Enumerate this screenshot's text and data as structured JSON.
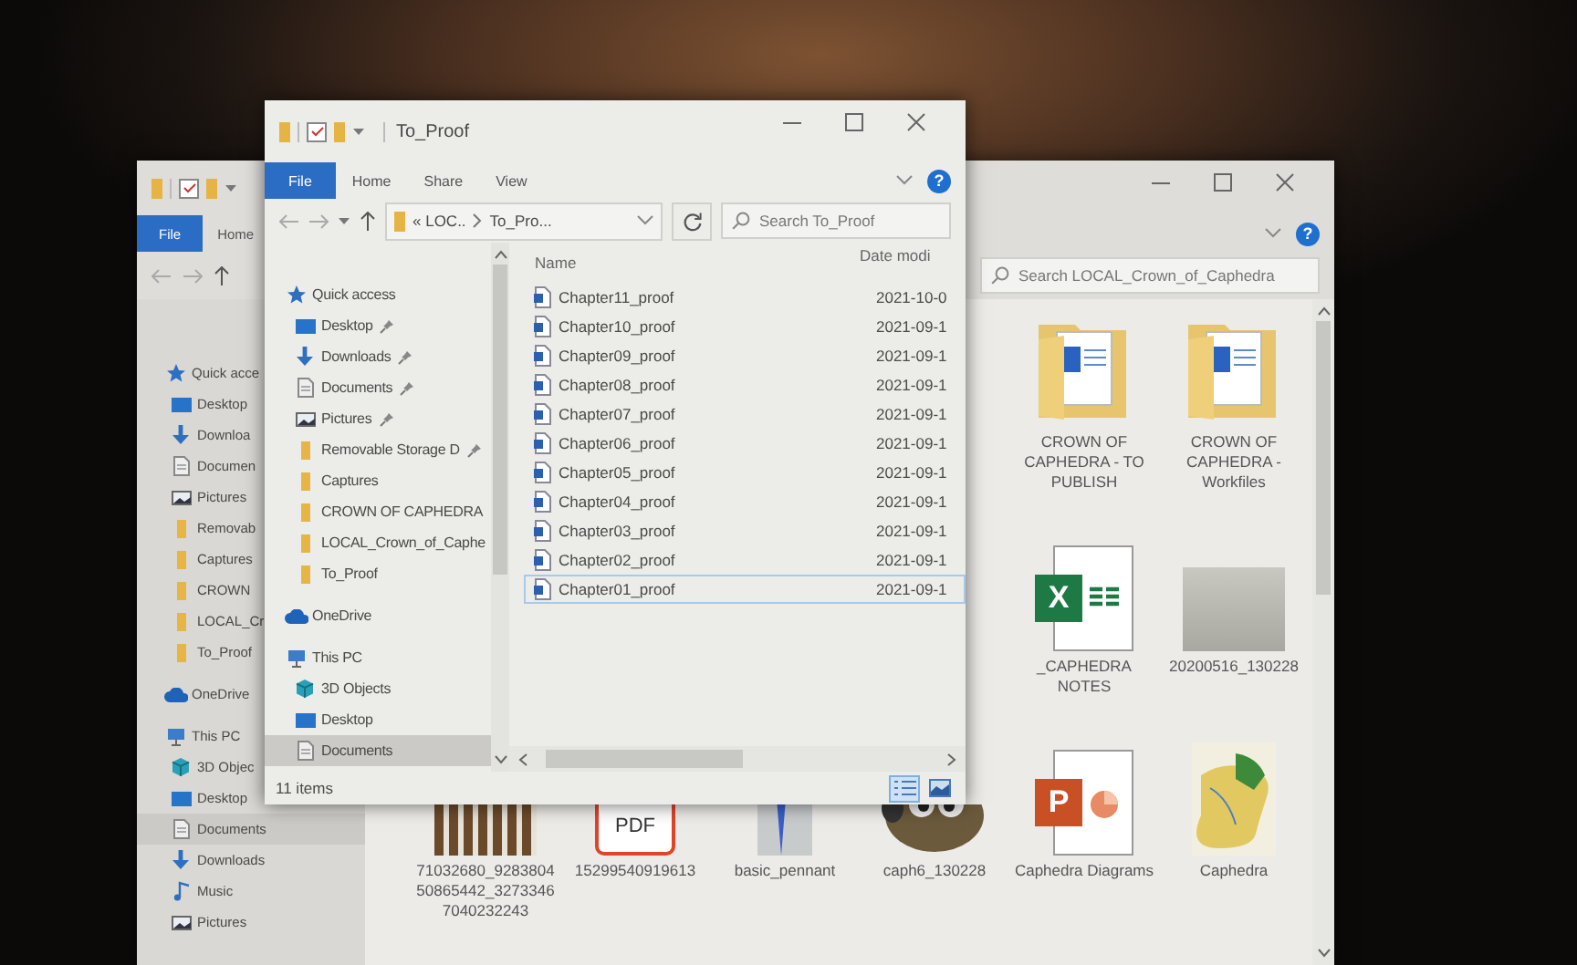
{
  "back_window": {
    "tabs": [
      {
        "label": "File",
        "kind": "file"
      },
      {
        "label": "Home",
        "kind": "tab"
      }
    ],
    "help_label": "?",
    "search": {
      "placeholder": "Search LOCAL_Crown_of_Caphedra"
    },
    "nav": [
      {
        "label": "Quick acce",
        "kind": "quick_access",
        "selected": false,
        "children": [
          {
            "label": "Desktop",
            "kind": "desktop",
            "selected": false
          },
          {
            "label": "Downloa",
            "kind": "downloads",
            "selected": false
          },
          {
            "label": "Documen",
            "kind": "documents",
            "selected": false
          },
          {
            "label": "Pictures",
            "kind": "pictures",
            "selected": false
          },
          {
            "label": "Removab",
            "kind": "folder",
            "selected": false
          },
          {
            "label": "Captures",
            "kind": "folder",
            "selected": false
          },
          {
            "label": "CROWN",
            "kind": "folder",
            "selected": false
          },
          {
            "label": "LOCAL_Cr",
            "kind": "folder",
            "selected": false
          },
          {
            "label": "To_Proof",
            "kind": "folder",
            "selected": false
          }
        ]
      },
      {
        "label": "OneDrive",
        "kind": "onedrive",
        "selected": false
      },
      {
        "label": "This PC",
        "kind": "this_pc",
        "selected": false,
        "children": [
          {
            "label": "3D Objec",
            "kind": "objects_3d",
            "selected": false
          },
          {
            "label": "Desktop",
            "kind": "desktop",
            "selected": false
          },
          {
            "label": "Documents",
            "kind": "documents",
            "selected": true
          },
          {
            "label": "Downloads",
            "kind": "downloads",
            "selected": false
          },
          {
            "label": "Music",
            "kind": "music",
            "selected": false
          },
          {
            "label": "Pictures",
            "kind": "pictures",
            "selected": false
          }
        ]
      }
    ],
    "icon_rows": [
      [
        {
          "label": "CROWN OF CAPHEDRA - TO PUBLISH",
          "kind": "folder"
        },
        {
          "label": "CROWN OF CAPHEDRA - Workfiles",
          "kind": "folder"
        }
      ],
      [
        {
          "label": "_CAPHEDRA NOTES",
          "kind": "spreadsheet",
          "letter": "X"
        },
        {
          "label": "20200516_130228",
          "kind": "photo"
        }
      ],
      [
        {
          "label": "71032680_928380450865442_32733467040232243",
          "kind": "chart_image"
        },
        {
          "label": "15299540919613",
          "kind": "pdf",
          "letter": "PDF"
        },
        {
          "label": "basic_pennant",
          "kind": "pennant"
        },
        {
          "label": "caph6_130228",
          "kind": "mascot"
        },
        {
          "label": "Caphedra Diagrams",
          "kind": "presentation",
          "letter": "P"
        },
        {
          "label": "Caphedra",
          "kind": "map"
        }
      ]
    ]
  },
  "front_window": {
    "title": "To_Proof",
    "tabs": [
      {
        "label": "File",
        "kind": "file"
      },
      {
        "label": "Home",
        "kind": "tab"
      },
      {
        "label": "Share",
        "kind": "tab"
      },
      {
        "label": "View",
        "kind": "tab"
      }
    ],
    "help_label": "?",
    "address": [
      "« LOC..",
      "To_Pro..."
    ],
    "search": {
      "placeholder": "Search To_Proof"
    },
    "nav": [
      {
        "label": "Quick access",
        "kind": "quick_access",
        "selected": false,
        "pinned": false,
        "children": [
          {
            "label": "Desktop",
            "kind": "desktop",
            "selected": false,
            "pinned": true
          },
          {
            "label": "Downloads",
            "kind": "downloads",
            "selected": false,
            "pinned": true
          },
          {
            "label": "Documents",
            "kind": "documents",
            "selected": false,
            "pinned": true
          },
          {
            "label": "Pictures",
            "kind": "pictures",
            "selected": false,
            "pinned": true
          },
          {
            "label": "Removable Storage D",
            "kind": "folder",
            "selected": false,
            "pinned": true
          },
          {
            "label": "Captures",
            "kind": "folder",
            "selected": false,
            "pinned": false
          },
          {
            "label": "CROWN OF CAPHEDRA",
            "kind": "folder",
            "selected": false,
            "pinned": false
          },
          {
            "label": "LOCAL_Crown_of_Caphe",
            "kind": "folder",
            "selected": false,
            "pinned": false
          },
          {
            "label": "To_Proof",
            "kind": "folder",
            "selected": false,
            "pinned": false
          }
        ]
      },
      {
        "label": "OneDrive",
        "kind": "onedrive",
        "selected": false,
        "pinned": false
      },
      {
        "label": "This PC",
        "kind": "this_pc",
        "selected": false,
        "pinned": false,
        "children": [
          {
            "label": "3D Objects",
            "kind": "objects_3d",
            "selected": false,
            "pinned": false
          },
          {
            "label": "Desktop",
            "kind": "desktop",
            "selected": false,
            "pinned": false
          },
          {
            "label": "Documents",
            "kind": "documents",
            "selected": true,
            "pinned": false
          }
        ]
      }
    ],
    "columns": [
      "Name",
      "Date modi"
    ],
    "files": [
      {
        "name": "Chapter11_proof",
        "date": "2021-10-0",
        "focused": false
      },
      {
        "name": "Chapter10_proof",
        "date": "2021-09-1",
        "focused": false
      },
      {
        "name": "Chapter09_proof",
        "date": "2021-09-1",
        "focused": false
      },
      {
        "name": "Chapter08_proof",
        "date": "2021-09-1",
        "focused": false
      },
      {
        "name": "Chapter07_proof",
        "date": "2021-09-1",
        "focused": false
      },
      {
        "name": "Chapter06_proof",
        "date": "2021-09-1",
        "focused": false
      },
      {
        "name": "Chapter05_proof",
        "date": "2021-09-1",
        "focused": false
      },
      {
        "name": "Chapter04_proof",
        "date": "2021-09-1",
        "focused": false
      },
      {
        "name": "Chapter03_proof",
        "date": "2021-09-1",
        "focused": false
      },
      {
        "name": "Chapter02_proof",
        "date": "2021-09-1",
        "focused": false
      },
      {
        "name": "Chapter01_proof",
        "date": "2021-09-1",
        "focused": true
      }
    ],
    "status": "11 items",
    "views": [
      {
        "kind": "details",
        "selected": true
      },
      {
        "kind": "large_icons",
        "selected": false
      }
    ]
  }
}
